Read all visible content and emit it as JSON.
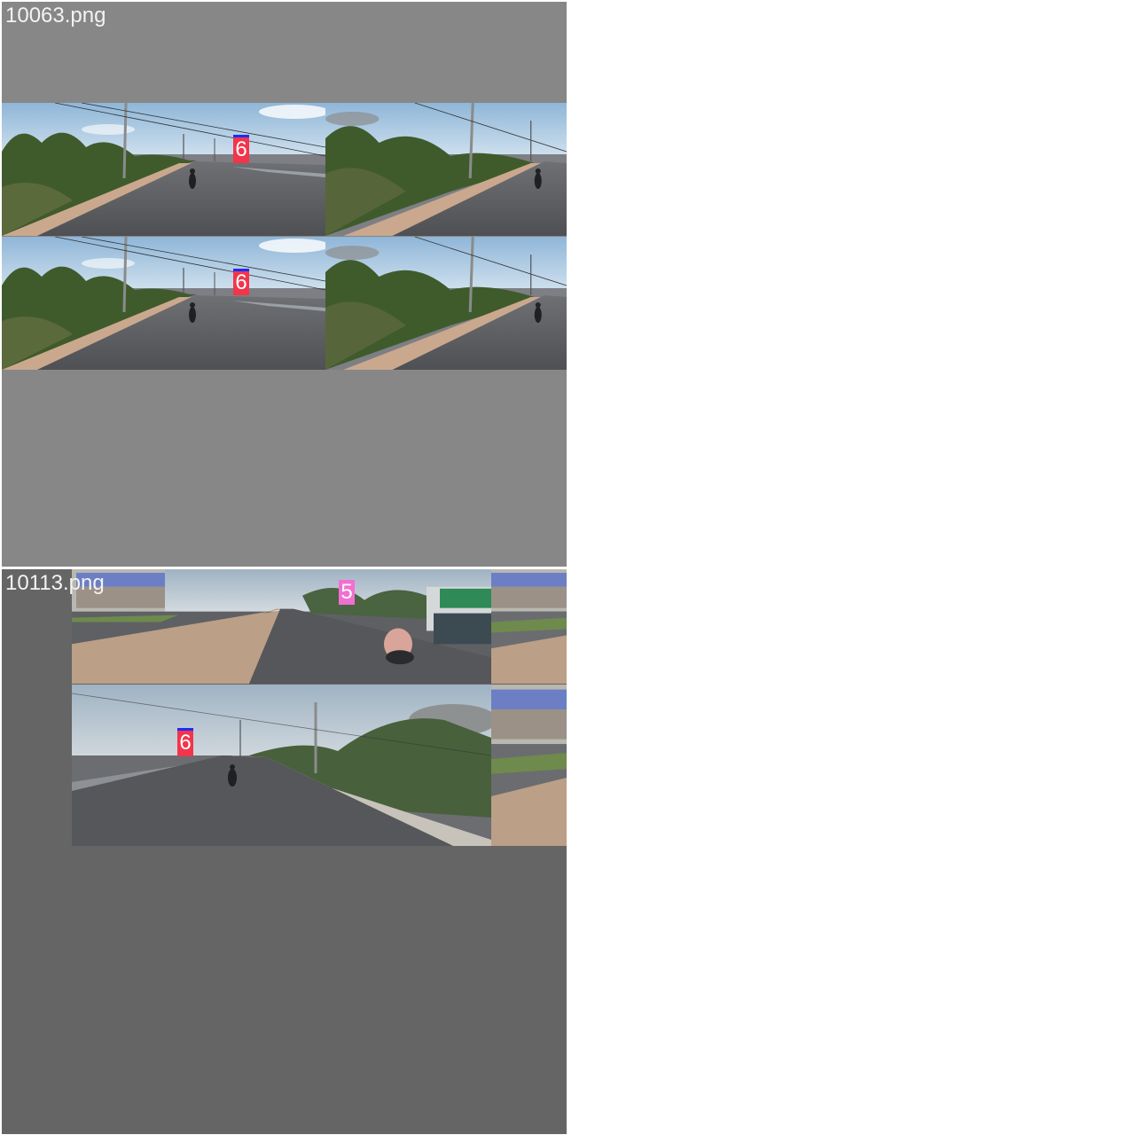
{
  "panels": [
    {
      "filename": "10063.png",
      "labels": [
        "6",
        "6"
      ]
    },
    {
      "filename": "10113.png",
      "labels": [
        "5",
        "6"
      ]
    }
  ],
  "colors": {
    "panel_1_bg": "#878787",
    "panel_2_bg": "#656565",
    "label_6": "#f2354b",
    "label_5": "#f26fd2",
    "label_cap": "#1c2cff"
  },
  "icons": [
    "road-scene-image",
    "motorcycle-rider",
    "roadside-shop-scene"
  ]
}
